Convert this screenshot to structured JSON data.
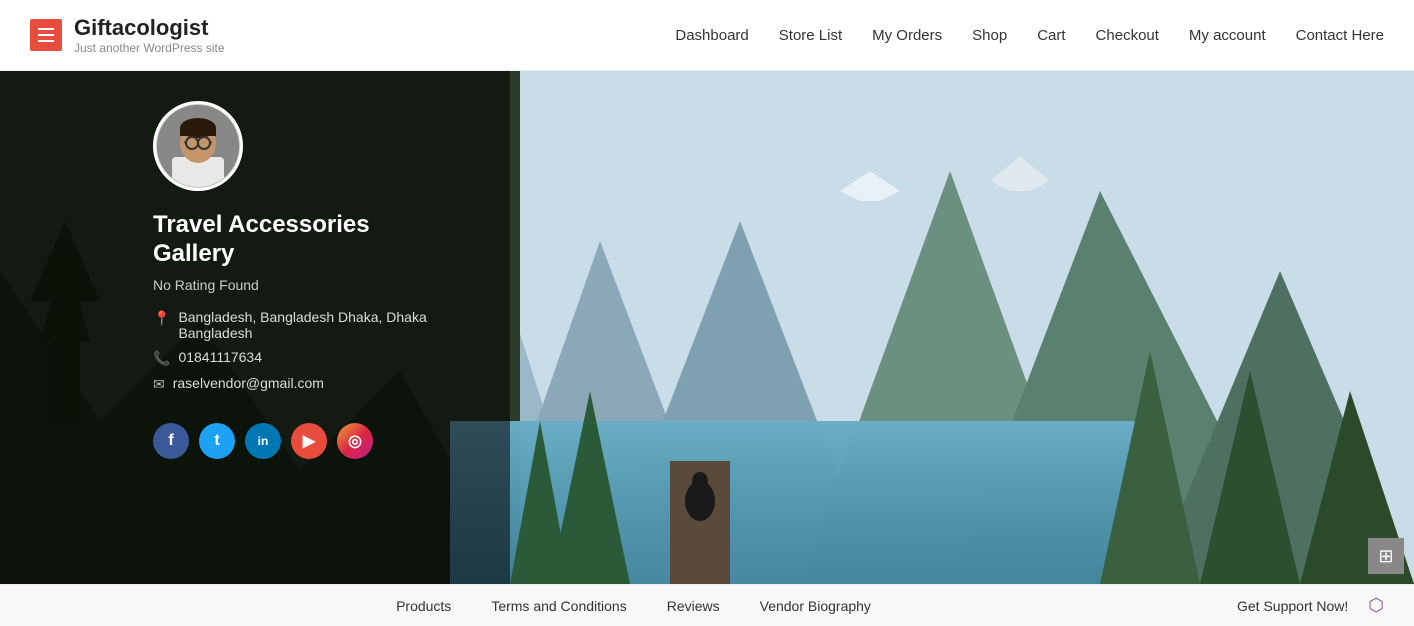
{
  "header": {
    "menu_icon_label": "☰",
    "logo_title": "Giftacologist",
    "logo_subtitle": "Just another WordPress site",
    "nav_items": [
      {
        "label": "Dashboard",
        "href": "#"
      },
      {
        "label": "Store List",
        "href": "#"
      },
      {
        "label": "My Orders",
        "href": "#"
      },
      {
        "label": "Shop",
        "href": "#"
      },
      {
        "label": "Cart",
        "href": "#"
      },
      {
        "label": "Checkout",
        "href": "#"
      },
      {
        "label": "My account",
        "href": "#"
      },
      {
        "label": "Contact Here",
        "href": "#"
      }
    ]
  },
  "store": {
    "name_line1": "Travel Accessories",
    "name_line2": "Gallery",
    "rating": "No Rating Found",
    "location": "Bangladesh, Bangladesh Dhaka, Dhaka Bangladesh",
    "phone": "01841117634",
    "email": "raselvendor@gmail.com"
  },
  "social": [
    {
      "label": "f",
      "class": "social-fb",
      "name": "facebook"
    },
    {
      "label": "t",
      "class": "social-tw",
      "name": "twitter"
    },
    {
      "label": "in",
      "class": "social-li",
      "name": "linkedin"
    },
    {
      "label": "▶",
      "class": "social-yt",
      "name": "youtube"
    },
    {
      "label": "◎",
      "class": "social-ig",
      "name": "instagram"
    }
  ],
  "footer": {
    "nav_items": [
      {
        "label": "Products"
      },
      {
        "label": "Terms and Conditions"
      },
      {
        "label": "Reviews"
      },
      {
        "label": "Vendor Biography"
      }
    ],
    "support_label": "Get Support Now!"
  }
}
